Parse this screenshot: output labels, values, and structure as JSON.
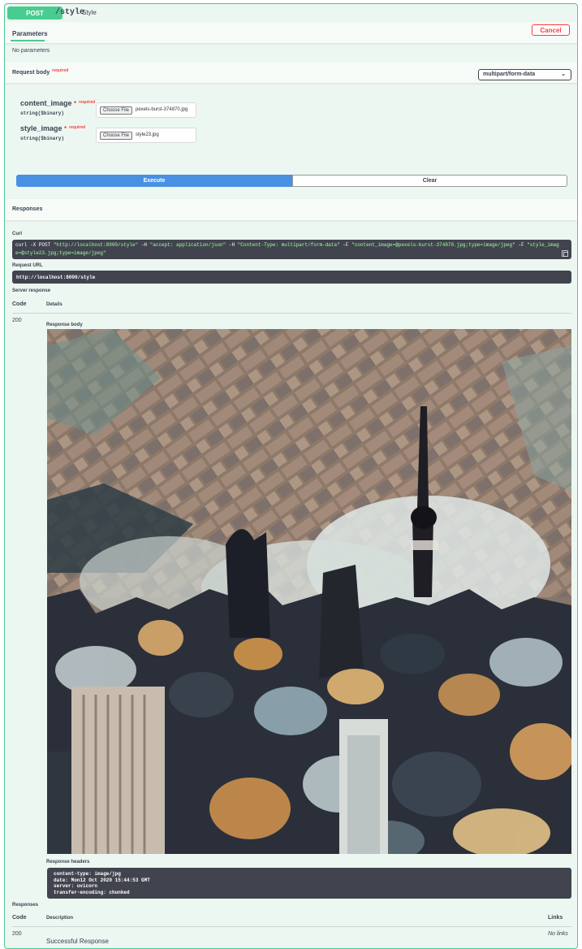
{
  "operation": {
    "method": "POST",
    "path": "/style",
    "summary": "Style"
  },
  "parameters_tab": {
    "title": "Parameters",
    "cancel_label": "Cancel",
    "no_params": "No parameters"
  },
  "request_body": {
    "title": "Request body",
    "required_label": "required",
    "content_type": "multipart/form-data",
    "fields": [
      {
        "name": "content_image",
        "required_star": "*",
        "required_label": "required",
        "type": "string($binary)",
        "choose_label": "Choose File",
        "file_name": "pexels-burst-374870.jpg"
      },
      {
        "name": "style_image",
        "required_star": "*",
        "required_label": "required",
        "type": "string($binary)",
        "choose_label": "Choose File",
        "file_name": "style23.jpg"
      }
    ]
  },
  "actions": {
    "execute_label": "Execute",
    "clear_label": "Clear"
  },
  "responses_section": {
    "title": "Responses",
    "curl_label": "Curl",
    "curl_cmd_prefix": "curl -X POST ",
    "curl_url": "\"http://localhost:8000/style\"",
    "curl_h1_flag": " -H ",
    "curl_h1": " \"accept: application/json\"",
    "curl_h2_flag": " -H ",
    "curl_h2": " \"Content-Type: multipart/form-data\"",
    "curl_f1_flag": " -F ",
    "curl_f1": "\"content_image=@pexels-burst-374870.jpg;type=image/jpeg\"",
    "curl_f2_flag": " -F ",
    "curl_f2": "\"style_image=@style23.jpg;type=image/jpeg\"",
    "request_url_label": "Request URL",
    "request_url": "http://localhost:8000/style",
    "server_response_label": "Server response",
    "code_header": "Code",
    "details_header": "Details",
    "code": "200",
    "response_body_label": "Response body",
    "response_headers_label": "Response headers",
    "response_headers": [
      "content-type: image/jpg",
      "date: Mon12 Oct 2020 15:44:53 GMT",
      "server: uvicorn",
      "transfer-encoding: chunked"
    ]
  },
  "responses_table": {
    "title": "Responses",
    "code_header": "Code",
    "description_header": "Description",
    "links_header": "Links",
    "rows": [
      {
        "code": "200",
        "description": "Successful Response",
        "links": "No links"
      }
    ]
  },
  "colors": {
    "post_green": "#49cc90",
    "execute_blue": "#4990e2",
    "cancel_red": "#f93e3e",
    "code_bg": "#41444e"
  }
}
